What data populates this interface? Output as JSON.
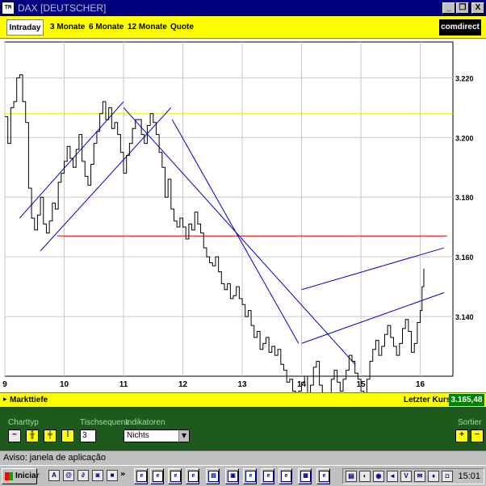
{
  "window": {
    "title": "DAX [DEUTSCHER]",
    "app_icon_text": "TM",
    "controls": {
      "minimize": "_",
      "restore": "❐",
      "close": "X"
    }
  },
  "tabs": [
    {
      "label": "Intraday",
      "active": true
    },
    {
      "label": "3 Monate",
      "active": false
    },
    {
      "label": "6 Monate",
      "active": false
    },
    {
      "label": "12 Monate",
      "active": false
    },
    {
      "label": "Quote",
      "active": false
    }
  ],
  "brand": "comdirect",
  "chart_data": {
    "type": "line",
    "x_ticks": [
      "9",
      "10",
      "11",
      "12",
      "13",
      "14",
      "15",
      "16"
    ],
    "y_ticks": [
      "3.140",
      "3.160",
      "3.180",
      "3.200",
      "3.220"
    ],
    "ylim": [
      3120,
      3232
    ],
    "xlim": [
      9,
      16.55
    ],
    "grid": true,
    "series": [
      {
        "x": [
          9.0,
          9.05,
          9.1,
          9.15,
          9.2,
          9.25,
          9.3,
          9.35,
          9.4,
          9.45,
          9.5,
          9.55,
          9.6,
          9.65,
          9.7,
          9.75,
          9.8,
          9.85,
          9.9,
          9.95,
          10.0,
          10.05,
          10.1,
          10.15,
          10.2,
          10.25,
          10.3,
          10.35,
          10.4,
          10.45,
          10.5,
          10.55,
          10.6,
          10.65,
          10.7,
          10.75,
          10.8,
          10.85,
          10.9,
          10.95,
          11.0,
          11.05,
          11.1,
          11.15,
          11.2,
          11.25,
          11.3,
          11.35,
          11.4,
          11.45,
          11.5,
          11.55,
          11.6,
          11.65,
          11.7,
          11.75,
          11.8,
          11.85,
          11.9,
          11.95,
          12.0,
          12.05,
          12.1,
          12.15,
          12.2,
          12.25,
          12.3,
          12.35,
          12.4,
          12.45,
          12.5,
          12.55,
          12.6,
          12.65,
          12.7,
          12.75,
          12.8,
          12.85,
          12.9,
          12.95,
          13.0,
          13.05,
          13.1,
          13.15,
          13.2,
          13.25,
          13.3,
          13.35,
          13.4,
          13.45,
          13.5,
          13.55,
          13.6,
          13.65,
          13.7,
          13.75,
          13.8,
          13.85,
          13.9,
          13.95,
          14.0,
          14.05,
          14.1,
          14.15,
          14.2,
          14.25,
          14.3,
          14.35,
          14.4,
          14.45,
          14.5,
          14.55,
          14.6,
          14.65,
          14.7,
          14.75,
          14.8,
          14.85,
          14.9,
          14.95,
          15.0,
          15.05,
          15.1,
          15.15,
          15.2,
          15.25,
          15.3,
          15.35,
          15.4,
          15.45,
          15.5,
          15.55,
          15.6,
          15.65,
          15.7,
          15.75,
          15.8,
          15.85,
          15.9,
          15.95,
          16.0,
          16.03,
          16.06
        ],
        "values": [
          3207,
          3198,
          3210,
          3212,
          3220,
          3221,
          3212,
          3205,
          3183,
          3173,
          3169,
          3174,
          3180,
          3171,
          3168,
          3172,
          3178,
          3176,
          3185,
          3188,
          3192,
          3197,
          3193,
          3190,
          3196,
          3201,
          3192,
          3187,
          3184,
          3191,
          3198,
          3202,
          3208,
          3212,
          3206,
          3210,
          3203,
          3205,
          3201,
          3195,
          3188,
          3194,
          3198,
          3203,
          3206,
          3206,
          3201,
          3198,
          3204,
          3208,
          3205,
          3201,
          3195,
          3190,
          3180,
          3186,
          3176,
          3172,
          3170,
          3173,
          3170,
          3166,
          3171,
          3169,
          3175,
          3171,
          3168,
          3163,
          3160,
          3158,
          3157,
          3160,
          3155,
          3151,
          3149,
          3151,
          3146,
          3147,
          3150,
          3146,
          3144,
          3140,
          3142,
          3137,
          3133,
          3135,
          3129,
          3131,
          3133,
          3128,
          3130,
          3127,
          3129,
          3124,
          3122,
          3118,
          3119,
          3115,
          3112,
          3115,
          3118,
          3120,
          3113,
          3117,
          3123,
          3125,
          3117,
          3112,
          3110,
          3113,
          3119,
          3122,
          3118,
          3115,
          3119,
          3122,
          3127,
          3125,
          3121,
          3119,
          3115,
          3114,
          3119,
          3125,
          3129,
          3132,
          3127,
          3130,
          3134,
          3137,
          3133,
          3130,
          3127,
          3131,
          3136,
          3139,
          3135,
          3128,
          3131,
          3138,
          3142,
          3150,
          3156
        ]
      }
    ],
    "reference_lines": {
      "yellow": 3208,
      "red": 3167
    },
    "title": "",
    "xlabel": "",
    "ylabel": ""
  },
  "info_bar": {
    "market_depth": "Markttiefe",
    "last_price_label": "Letzter Kurs",
    "last_price_value": "3.165,48"
  },
  "controls": {
    "chart_type_label": "Charttyp",
    "days_label": "Tischsequenz",
    "days_value": "3",
    "indicator_label": "Indikatoren",
    "indicator_value": "Nichts",
    "sort_label": "Sortier"
  },
  "status": "Aviso: janela de aplicação",
  "taskbar": {
    "start_label": "Iniciar",
    "clock": "15:01"
  }
}
